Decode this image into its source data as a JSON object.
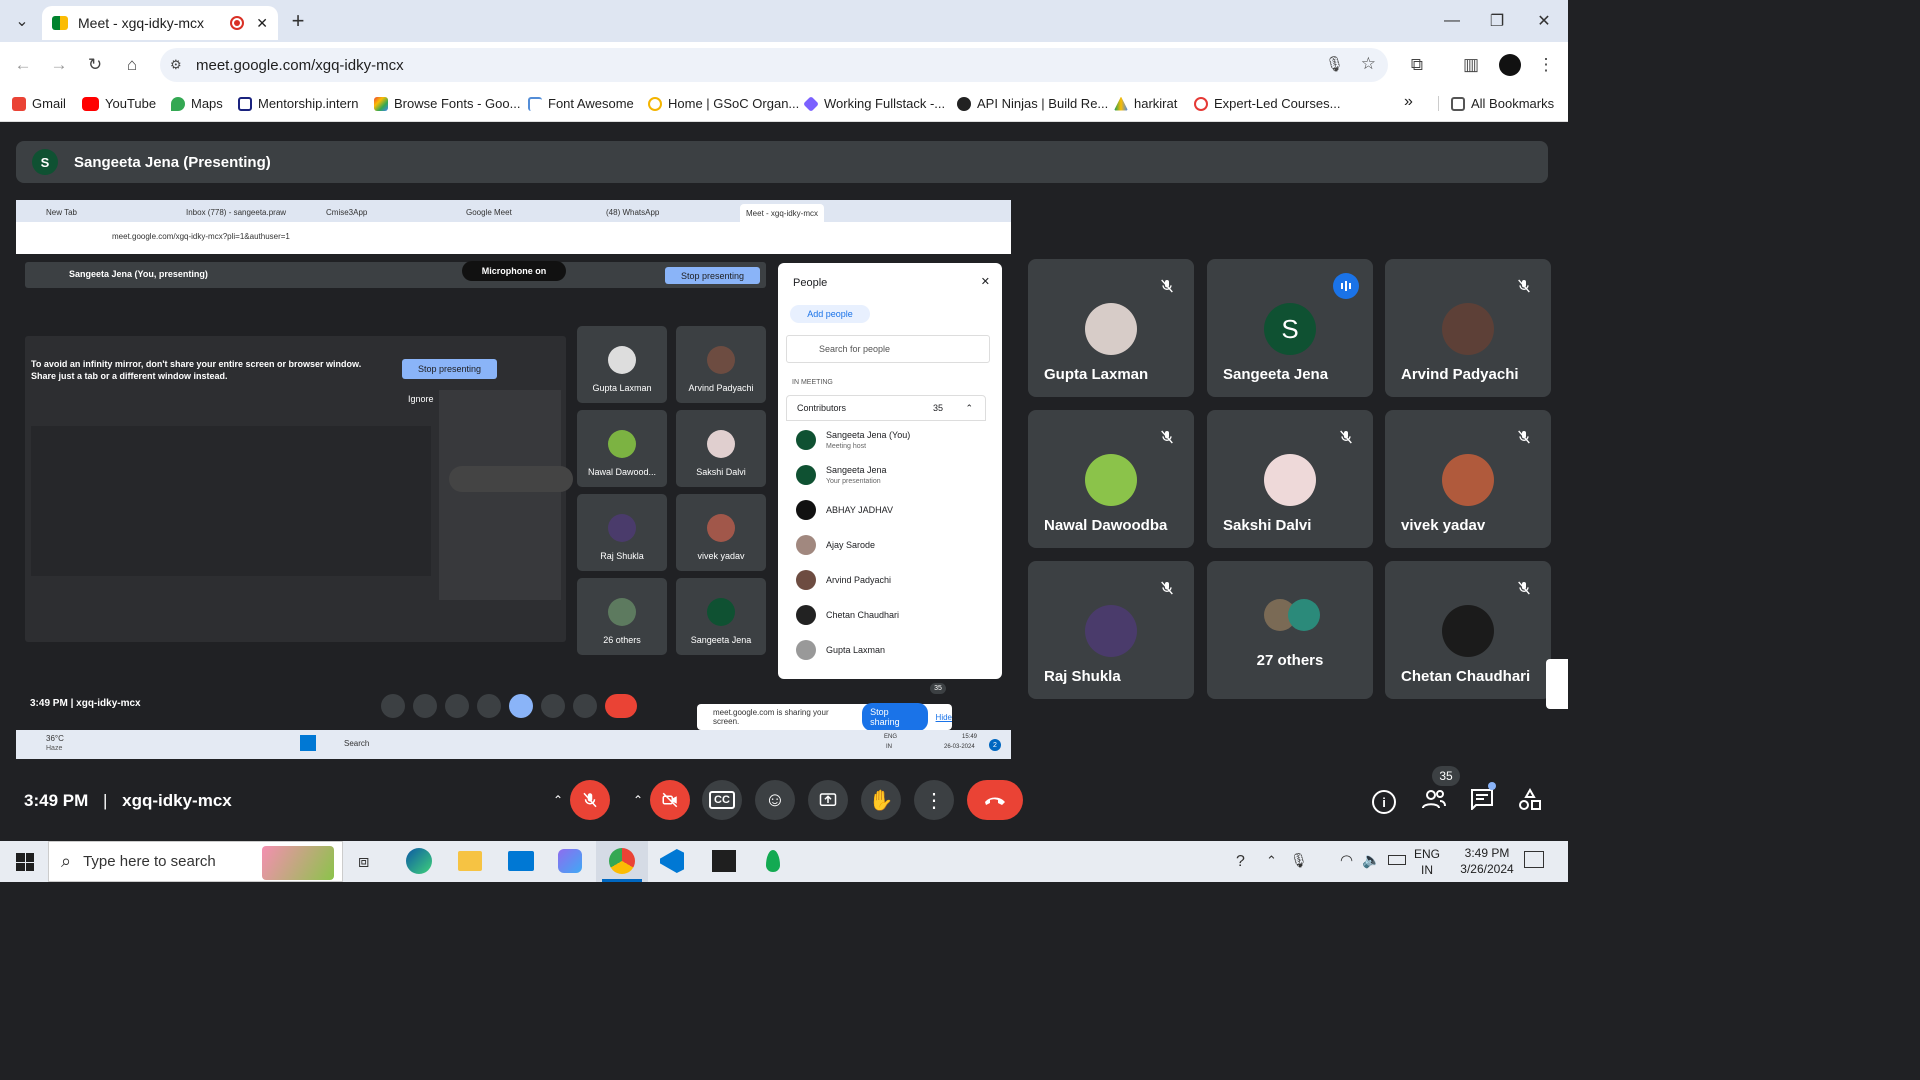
{
  "browser": {
    "tab_title": "Meet - xgq-idky-mcx",
    "url": "meet.google.com/xgq-idky-mcx",
    "bookmarks": [
      "Gmail",
      "YouTube",
      "Maps",
      "Mentorship.intern",
      "Browse Fonts - Goo...",
      "Font Awesome",
      "Home | GSoC Organ...",
      "Working Fullstack -...",
      "API Ninjas | Build Re...",
      "harkirat",
      "Expert-Led Courses..."
    ],
    "all_bookmarks": "All Bookmarks",
    "overflow": "»"
  },
  "presenter": {
    "initial": "S",
    "label": "Sangeeta Jena (Presenting)"
  },
  "tiles": [
    {
      "name": "Gupta Laxman",
      "muted": true,
      "avatar": "photo"
    },
    {
      "name": "Sangeeta Jena",
      "muted": false,
      "speaking": true,
      "initial": "S",
      "avatar_color": "#0f5132"
    },
    {
      "name": "Arvind Padyachi",
      "muted": true,
      "avatar": "photo"
    },
    {
      "name": "Nawal Dawoodba",
      "muted": true,
      "avatar": "photo"
    },
    {
      "name": "Sakshi Dalvi",
      "muted": true,
      "avatar": "photo"
    },
    {
      "name": "vivek yadav",
      "muted": true,
      "avatar": "photo"
    },
    {
      "name": "Raj Shukla",
      "muted": true,
      "avatar": "photo"
    },
    {
      "name": "27 others",
      "muted": false,
      "avatar": "group"
    },
    {
      "name": "Chetan Chaudhari",
      "muted": true,
      "avatar": "photo"
    }
  ],
  "shared_screen": {
    "tabs": [
      "New Tab",
      "Inbox (778) - sangeeta.praw",
      "Cmise3App",
      "Google Meet",
      "(48) WhatsApp",
      "Meet - xgq-idky-mcx"
    ],
    "url": "meet.google.com/xgq-idky-mcx?pli=1&authuser=1",
    "presenting_label": "Sangeeta Jena (You, presenting)",
    "mic_label": "Microphone on",
    "stop_presenting": "Stop presenting",
    "infinity_warning": "To avoid an infinity mirror, don't share your entire screen or browser window. Share just a tab or a different window instead.",
    "stop_presenting_inner": "Stop presenting",
    "ignore": "Ignore",
    "mini_tiles": [
      "Gupta Laxman",
      "Arvind Padyachi",
      "Nawal Dawood...",
      "Sakshi Dalvi",
      "Raj Shukla",
      "vivek yadav",
      "26 others",
      "Sangeeta Jena"
    ],
    "people_panel": {
      "title": "People",
      "add_people": "Add people",
      "search_placeholder": "Search for people",
      "in_meeting": "IN MEETING",
      "contributors": "Contributors",
      "count": "35",
      "rows": [
        {
          "name": "Sangeeta Jena (You)",
          "sub": "Meeting host"
        },
        {
          "name": "Sangeeta Jena",
          "sub": "Your presentation"
        },
        {
          "name": "ABHAY JADHAV",
          "sub": ""
        },
        {
          "name": "Ajay Sarode",
          "sub": ""
        },
        {
          "name": "Arvind Padyachi",
          "sub": ""
        },
        {
          "name": "Chetan Chaudhari",
          "sub": ""
        },
        {
          "name": "Gupta Laxman",
          "sub": ""
        }
      ]
    },
    "time": "3:49 PM",
    "code": "xgq-idky-mcx",
    "sharing_notice": "meet.google.com is sharing your screen.",
    "stop_sharing": "Stop sharing",
    "hide": "Hide",
    "badge": "35",
    "taskbar": {
      "temp": "36°C",
      "weather": "Haze",
      "search": "Search",
      "lang1": "ENG",
      "lang2": "IN",
      "clock": "15:49",
      "date": "26-03-2024",
      "notif": "2"
    }
  },
  "meeting": {
    "time": "3:49 PM",
    "separator": "|",
    "code": "xgq-idky-mcx",
    "people_count": "35"
  },
  "taskbar": {
    "search_placeholder": "Type here to search",
    "lang1": "ENG",
    "lang2": "IN",
    "time": "3:49 PM",
    "date": "3/26/2024"
  },
  "colors": {
    "meet_bg": "#202124",
    "tile_bg": "#3c4043",
    "end_call": "#ea4335",
    "accent_blue": "#1a73e8"
  }
}
